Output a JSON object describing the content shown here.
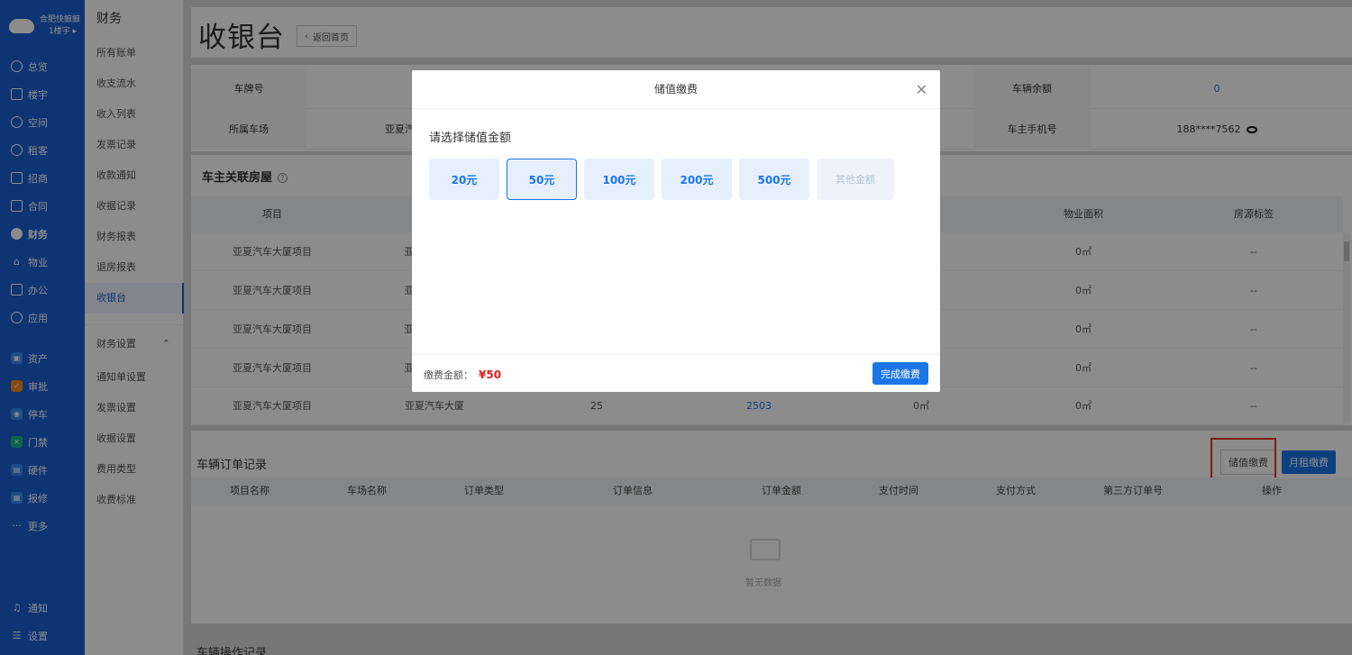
{
  "nav": {
    "org": "合肥快鲸鲸",
    "building": "1楼宇",
    "items": [
      {
        "label": "总览",
        "icon": "clock-icon"
      },
      {
        "label": "楼宇",
        "icon": "building-icon"
      },
      {
        "label": "空间",
        "icon": "cube-icon"
      },
      {
        "label": "租客",
        "icon": "users-icon"
      },
      {
        "label": "招商",
        "icon": "tag-icon"
      },
      {
        "label": "合同",
        "icon": "document-icon"
      },
      {
        "label": "财务",
        "icon": "finance-icon"
      },
      {
        "label": "物业",
        "icon": "home-icon"
      },
      {
        "label": "办公",
        "icon": "monitor-icon"
      },
      {
        "label": "应用",
        "icon": "apps-icon"
      }
    ],
    "apps": [
      {
        "label": "资产",
        "color": "#3a8ef6"
      },
      {
        "label": "审批",
        "color": "#f08a24"
      },
      {
        "label": "停车",
        "color": "#3a8ef6"
      },
      {
        "label": "门禁",
        "color": "#18b886"
      },
      {
        "label": "硬件",
        "color": "#3a8ef6"
      },
      {
        "label": "报修",
        "color": "#3a8ef6"
      }
    ],
    "more": "更多",
    "notify": "通知",
    "settings": "设置"
  },
  "subnav": {
    "title": "财务",
    "items": [
      "所有账单",
      "收支流水",
      "收入列表",
      "发票记录",
      "收款通知",
      "收据记录",
      "财务报表",
      "退房报表",
      "收银台"
    ],
    "section": "财务设置",
    "settings": [
      "通知单设置",
      "发票设置",
      "收据设置",
      "费用类型",
      "收费标准"
    ]
  },
  "page": {
    "title": "收银台",
    "back": "返回首页"
  },
  "info": {
    "plate_label": "车牌号",
    "balance_label": "车辆余额",
    "balance_value": "0",
    "lot_label": "所属车场",
    "lot_value_partial": "亚夏汽",
    "phone_label": "车主手机号",
    "phone_value": "188****7562"
  },
  "houses": {
    "title": "车主关联房屋",
    "headers": [
      "项目",
      "积",
      "物业面积",
      "房源标签"
    ],
    "rows": [
      {
        "project": "亚夏汽车大厦项目",
        "building": "亚",
        "area": "0㎡",
        "tag": "--"
      },
      {
        "project": "亚夏汽车大厦项目",
        "building": "亚",
        "area": "0㎡",
        "tag": "--"
      },
      {
        "project": "亚夏汽车大厦项目",
        "building": "亚",
        "area": "0㎡",
        "tag": "--"
      },
      {
        "project": "亚夏汽车大厦项目",
        "building": "亚",
        "area": "0㎡",
        "tag": "--"
      }
    ],
    "last_row": {
      "project": "亚夏汽车大厦项目",
      "building": "亚夏汽车大厦",
      "floor": "25",
      "room": "2503",
      "area1": "0㎡",
      "area2": "0㎡",
      "tag": "--"
    }
  },
  "orders": {
    "title": "车辆订单记录",
    "btn_stored": "储值缴费",
    "btn_monthly": "月租缴费",
    "headers": [
      "项目名称",
      "车场名称",
      "订单类型",
      "订单信息",
      "订单金额",
      "支付时间",
      "支付方式",
      "第三方订单号",
      "操作"
    ],
    "empty": "暂无数据"
  },
  "ops_title": "车辆操作记录",
  "modal": {
    "title": "储值缴费",
    "prompt": "请选择储值金额",
    "amounts": [
      "20元",
      "50元",
      "100元",
      "200元",
      "500元"
    ],
    "other": "其他金额",
    "total_label": "缴费金额：",
    "total_value": "¥50",
    "confirm": "完成缴费"
  }
}
